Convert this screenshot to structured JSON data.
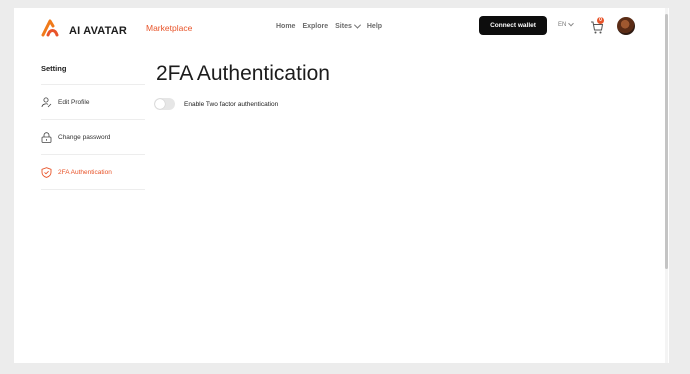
{
  "header": {
    "logo_text": "AI AVATAR",
    "marketplace": "Marketplace",
    "nav": [
      {
        "label": "Home"
      },
      {
        "label": "Explore"
      },
      {
        "label": "Sites"
      },
      {
        "label": "Help"
      }
    ],
    "connect_wallet": "Connect wallet",
    "language": "EN",
    "cart_count": "0"
  },
  "sidebar": {
    "title": "Setting",
    "items": [
      {
        "label": "Edit Profile",
        "icon": "user-edit-icon"
      },
      {
        "label": "Change password",
        "icon": "lock-icon"
      },
      {
        "label": "2FA Authentication",
        "icon": "shield-check-icon",
        "active": true
      }
    ]
  },
  "main": {
    "title": "2FA Authentication",
    "toggle_label": "Enable Two factor authentication",
    "toggle_on": false
  },
  "colors": {
    "accent": "#e8542a",
    "button_bg": "#0d0d0d"
  }
}
